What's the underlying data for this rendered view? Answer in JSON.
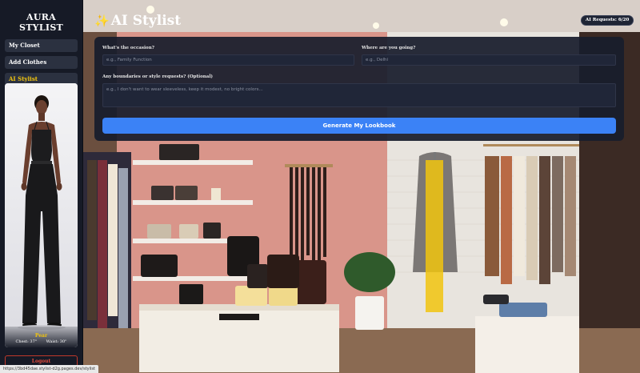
{
  "sidebar": {
    "brand": "AURA STYLIST",
    "items": [
      {
        "label": "My Closet",
        "active": false
      },
      {
        "label": "Add Clothes",
        "active": false
      },
      {
        "label": "AI Stylist",
        "active": true
      }
    ],
    "model": {
      "body_type": "Pear",
      "chest": "Chest: 37\"",
      "waist": "Waist: 30\""
    },
    "logout_label": "Logout"
  },
  "header": {
    "title": "AI Stylist",
    "title_icon": "sparkle-icon",
    "requests": "AI Requests: 6/20"
  },
  "form": {
    "occasion_label": "What's the occasion?",
    "occasion_placeholder": "e.g., Family Function",
    "destination_label": "Where are you going?",
    "destination_placeholder": "e.g., Delhi",
    "boundaries_label": "Any boundaries or style requests? (Optional)",
    "boundaries_placeholder": "e.g., I don't want to wear sleeveless, keep it modest, no bright colors...",
    "submit_label": "Generate My Lookbook"
  },
  "status_url": "https://3bd45dae.stylist-d2g.pages.dev/stylist",
  "colors": {
    "accent": "#f1c40f",
    "primary_button": "#3b82f6",
    "sidebar_bg": "#161a26",
    "danger": "#e74c3c"
  }
}
